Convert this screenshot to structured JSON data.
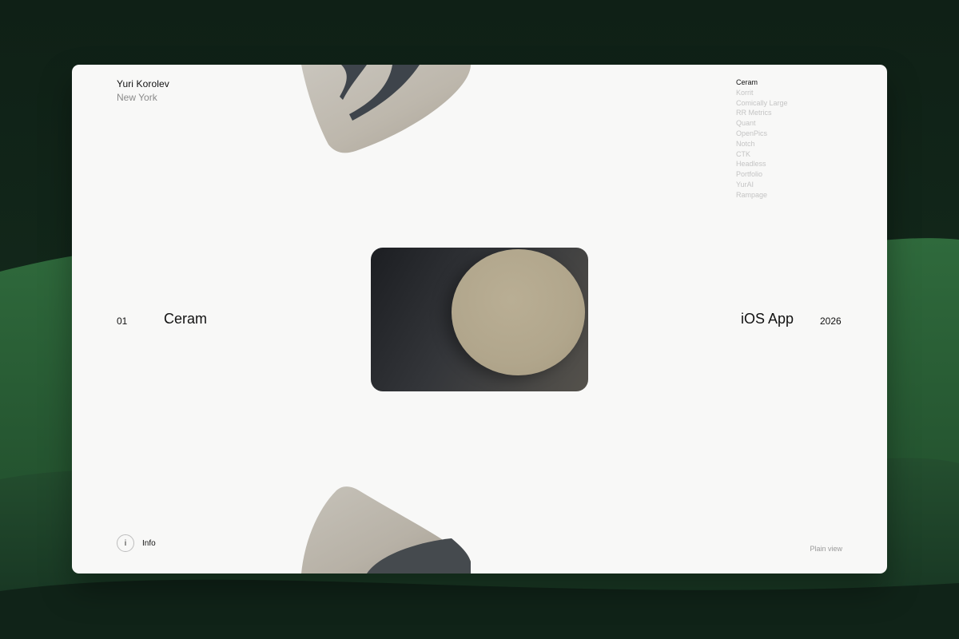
{
  "owner": {
    "name": "Yuri Korolev",
    "city": "New York"
  },
  "project_nav": {
    "items": [
      "Ceram",
      "Korrit",
      "Comically Large",
      "RR Metrics",
      "Quant",
      "OpenPics",
      "Notch",
      "CTK",
      "Headless",
      "Portfolio",
      "YurAI",
      "Rampage"
    ],
    "active": "Ceram"
  },
  "current_project": {
    "index": "01",
    "title": "Ceram",
    "type": "iOS App",
    "year": "2026"
  },
  "footer": {
    "info_icon": "i",
    "info_label": "Info",
    "plain_view_label": "Plain view"
  },
  "colors": {
    "background": "#142a1c",
    "window": "#f8f8f7",
    "text": "#111111",
    "muted": "#c4c4c4"
  }
}
